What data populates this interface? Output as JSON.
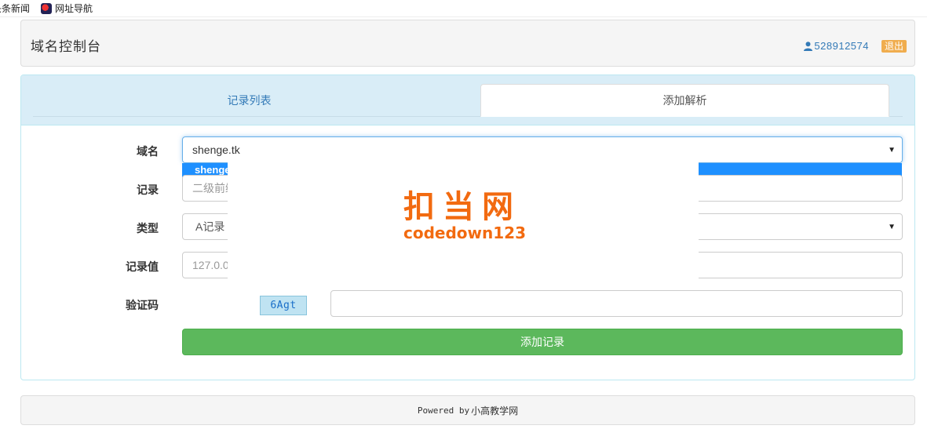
{
  "bookmarks": [
    {
      "label": "头条新闻"
    },
    {
      "label": "网址导航"
    }
  ],
  "header": {
    "title": "域名控制台",
    "user_id": "528912574",
    "logout_label": "退出"
  },
  "tabs": [
    {
      "label": "记录列表",
      "active": false
    },
    {
      "label": "添加解析",
      "active": true
    }
  ],
  "form": {
    "domain": {
      "label": "域名",
      "value": "shenge.tk",
      "dropdown_option": "shenge.tk"
    },
    "record": {
      "label": "记录",
      "placeholder": "二级前缀"
    },
    "type": {
      "label": "类型",
      "value": "A记录"
    },
    "record_value": {
      "label": "记录值",
      "placeholder": "127.0.0.1"
    },
    "captcha": {
      "label": "验证码",
      "code": "6Agt",
      "value": ""
    },
    "submit_label": "添加记录"
  },
  "watermark": {
    "title": "扣当网",
    "subtitle": "codedown123"
  },
  "footer": {
    "powered_by": "Powered by",
    "site": "小高教学网"
  },
  "colors": {
    "tab_strip": "#d9edf7",
    "link": "#337ab7",
    "logout": "#f0ad4e",
    "submit": "#5cb85c",
    "dropdown_highlight": "#1e90ff",
    "watermark": "#f26a10"
  }
}
